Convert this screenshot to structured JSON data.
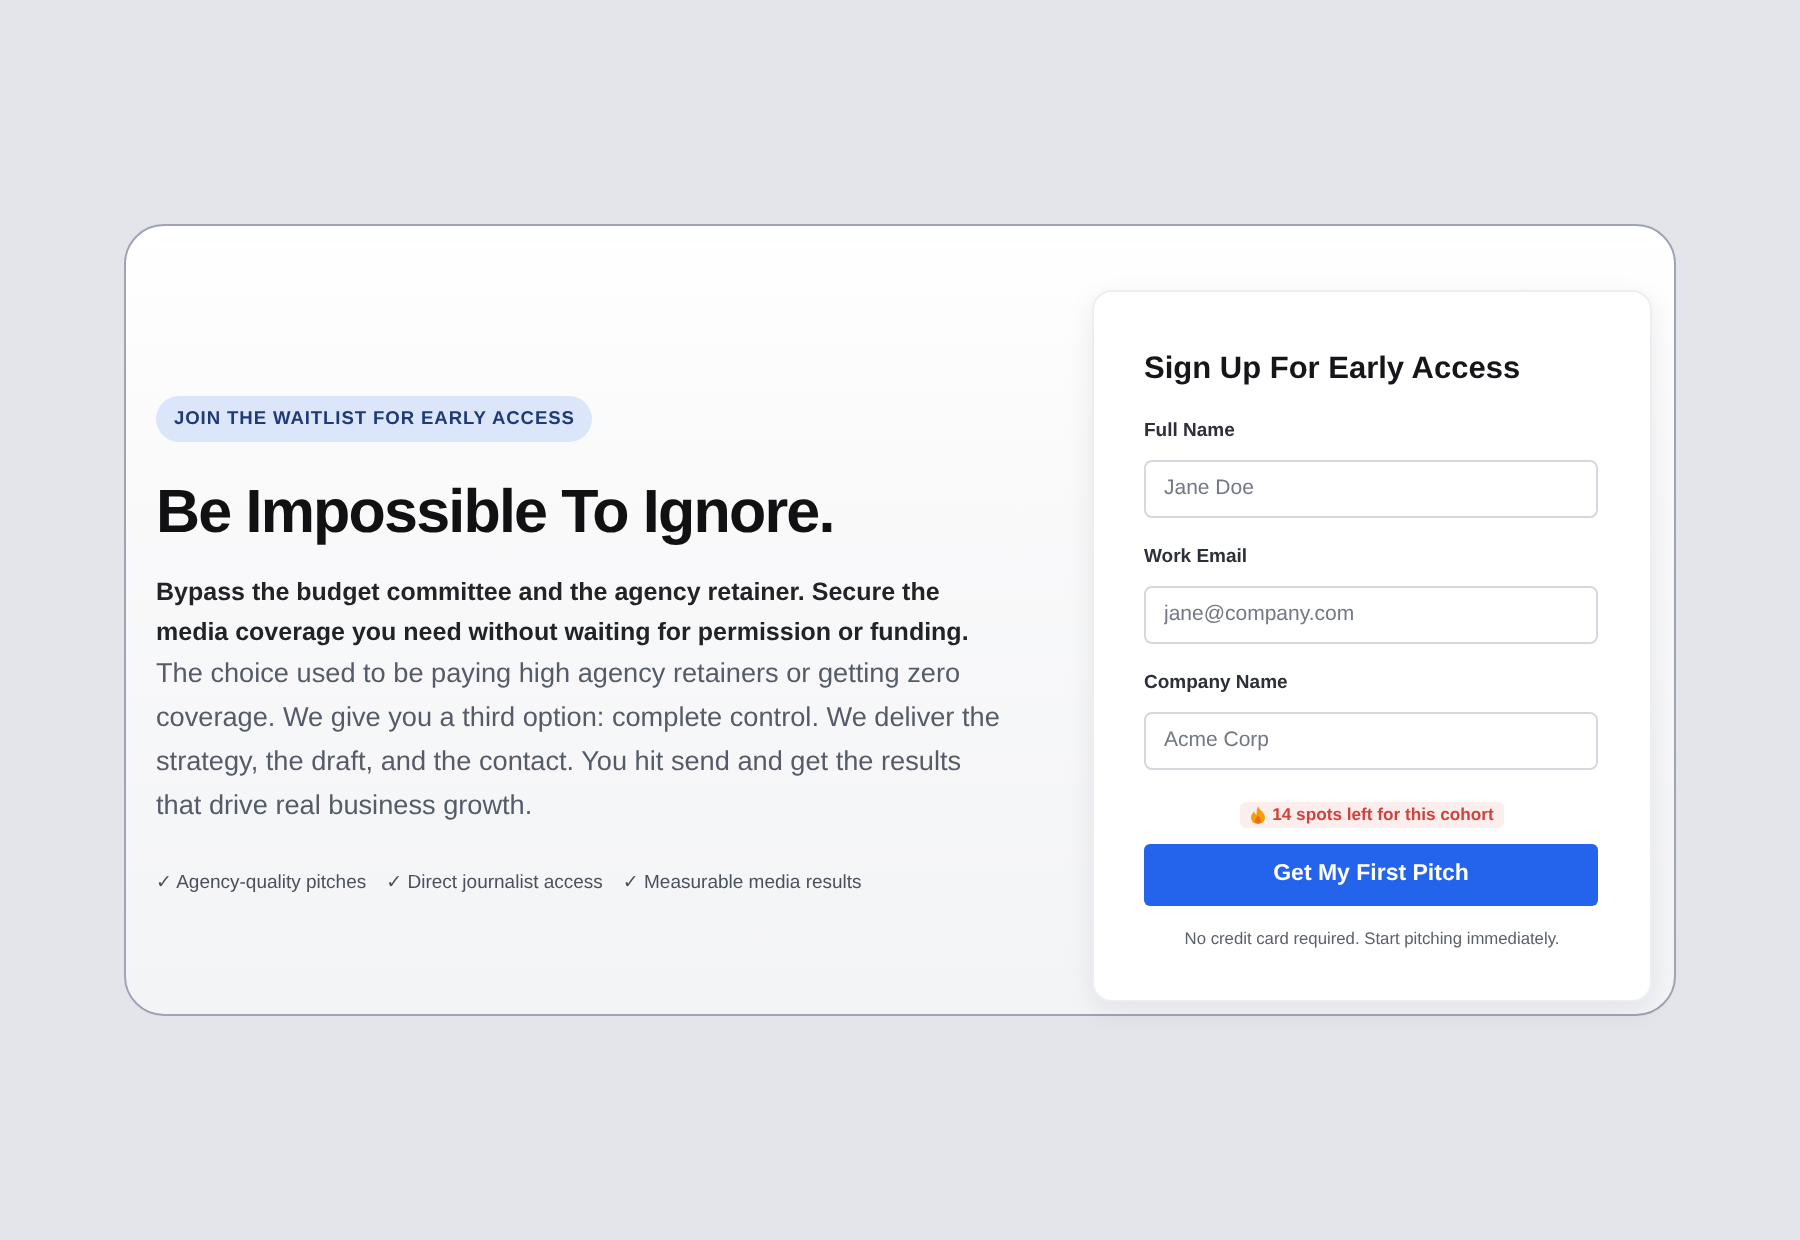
{
  "hero": {
    "badge": "JOIN THE WAITLIST FOR EARLY ACCESS",
    "title": "Be Impossible To Ignore.",
    "body": "**Bypass the budget committee and the agency retainer. Secure the media coverage you need without waiting for permission or funding.** The choice used to be paying high agency retainers or getting zero coverage. We give you a third option: complete control. We deliver the strategy, the draft, and the contact. You hit send and get the results that drive real business growth.",
    "features": [
      "✓ Agency-quality pitches",
      "✓ Direct journalist access",
      "✓ Measurable media results"
    ]
  },
  "form": {
    "title": "Sign Up For Early Access",
    "fields": [
      {
        "label": "Full Name",
        "placeholder": "Jane Doe"
      },
      {
        "label": "Work Email",
        "placeholder": "jane@company.com"
      },
      {
        "label": "Company Name",
        "placeholder": "Acme Corp"
      }
    ],
    "scarcity": "14 spots left for this cohort",
    "submit": "Get My First Pitch",
    "note": "No credit card required. Start pitching immediately."
  }
}
